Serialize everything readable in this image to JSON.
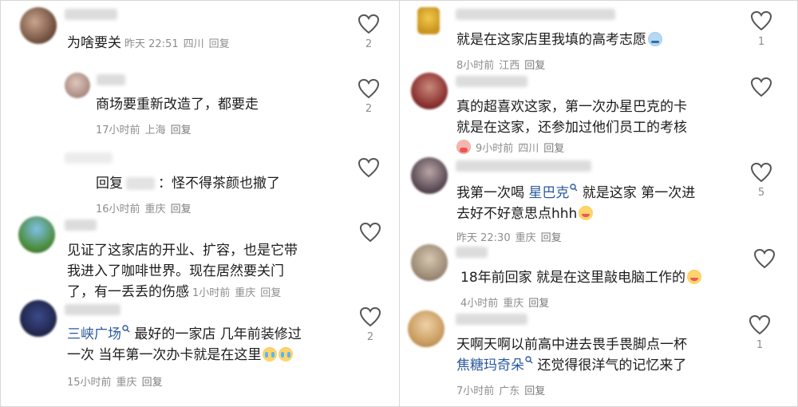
{
  "left": [
    {
      "text_lines": [
        "为啥要关"
      ],
      "inline_meta": [
        "昨天 22:51",
        "四川",
        "回复"
      ],
      "likes": "2"
    },
    {
      "text_lines": [
        "商场要重新改造了，都要走"
      ],
      "meta": [
        "17小时前",
        "上海",
        "回复"
      ],
      "likes": "2"
    },
    {
      "reply_prefix": "回复",
      "reply_rest": "：怪不得茶颜也撤了",
      "meta": [
        "16小时前",
        "重庆",
        "回复"
      ],
      "likes": ""
    },
    {
      "text_lines": [
        "见证了这家店的开业、扩容，也是它带",
        "我进入了咖啡世界。现在居然要关门",
        "了，有一丢丢的伤感"
      ],
      "inline_meta": [
        "1小时前",
        "重庆",
        "回复"
      ],
      "likes": ""
    },
    {
      "link": "三峡广场",
      "text_after_link": " 最好的一家店 几年前装修过",
      "line2": "一次 当年第一次办卡就是在这里",
      "meta": [
        "15小时前",
        "重庆",
        "回复"
      ],
      "likes": "2"
    }
  ],
  "right": [
    {
      "text_lines": [
        "就是在这家店里我填的高考志愿"
      ],
      "meta": [
        "8小时前",
        "江西",
        "回复"
      ],
      "likes": "1"
    },
    {
      "text_lines": [
        "真的超喜欢这家，第一次办星巴克的卡",
        "就是在这家，还参加过他们员工的考核"
      ],
      "meta": [
        "9小时前",
        "四川",
        "回复"
      ],
      "likes": ""
    },
    {
      "prefix": "我第一次喝 ",
      "link": "星巴克",
      "suffix": " 就是这家 第一次进",
      "line2": "去好不好意思点hhh",
      "meta": [
        "昨天 22:30",
        "重庆",
        "回复"
      ],
      "likes": "5"
    },
    {
      "text_lines": [
        "18年前回家 就是在这里敲电脑工作的"
      ],
      "meta": [
        "4小时前",
        "重庆",
        "回复"
      ],
      "likes": ""
    },
    {
      "line1": "天啊天啊以前高中进去畏手畏脚点一杯",
      "link": "焦糖玛奇朵",
      "suffix": " 还觉得很洋气的记忆来了",
      "meta": [
        "7小时前",
        "广东",
        "回复"
      ],
      "likes": "1"
    }
  ]
}
